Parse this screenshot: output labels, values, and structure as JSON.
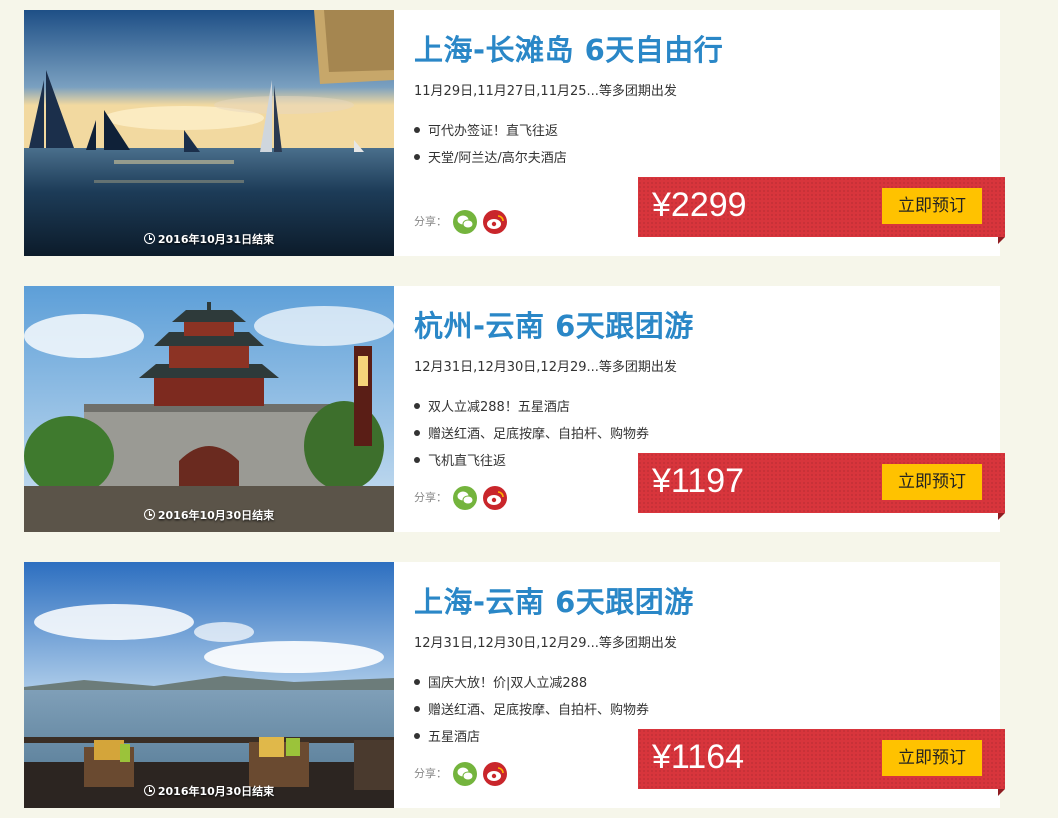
{
  "share_label": "分享：",
  "book_label": "立即预订",
  "colors": {
    "title": "#2a87c7",
    "price_bg": "#d8353c",
    "book_bg": "#ffc200",
    "page_bg": "#f6f6ea"
  },
  "tours": [
    {
      "title": "上海-长滩岛 6天自由行",
      "dates": "11月29日,11月27日,11月25...等多团期出发",
      "features": [
        "可代办签证！直飞往返",
        "天堂/阿兰达/高尔夫酒店"
      ],
      "price": "¥2299",
      "end_date": "2016年10月31日结束",
      "photo": "sailboats-at-sunset"
    },
    {
      "title": "杭州-云南 6天跟团游",
      "dates": "12月31日,12月30日,12月29...等多团期出发",
      "features": [
        "双人立减288！五星酒店",
        "赠送红酒、足底按摩、自拍杆、购物券",
        "飞机直飞往返"
      ],
      "price": "¥1197",
      "end_date": "2016年10月30日结束",
      "photo": "chinese-pagoda-gate"
    },
    {
      "title": "上海-云南 6天跟团游",
      "dates": "12月31日,12月30日,12月29...等多团期出发",
      "features": [
        "国庆大放！价|双人立减288",
        "赠送红酒、足底按摩、自拍杆、购物券",
        "五星酒店"
      ],
      "price": "¥1164",
      "end_date": "2016年10月30日结束",
      "photo": "lake-terrace-view"
    }
  ]
}
